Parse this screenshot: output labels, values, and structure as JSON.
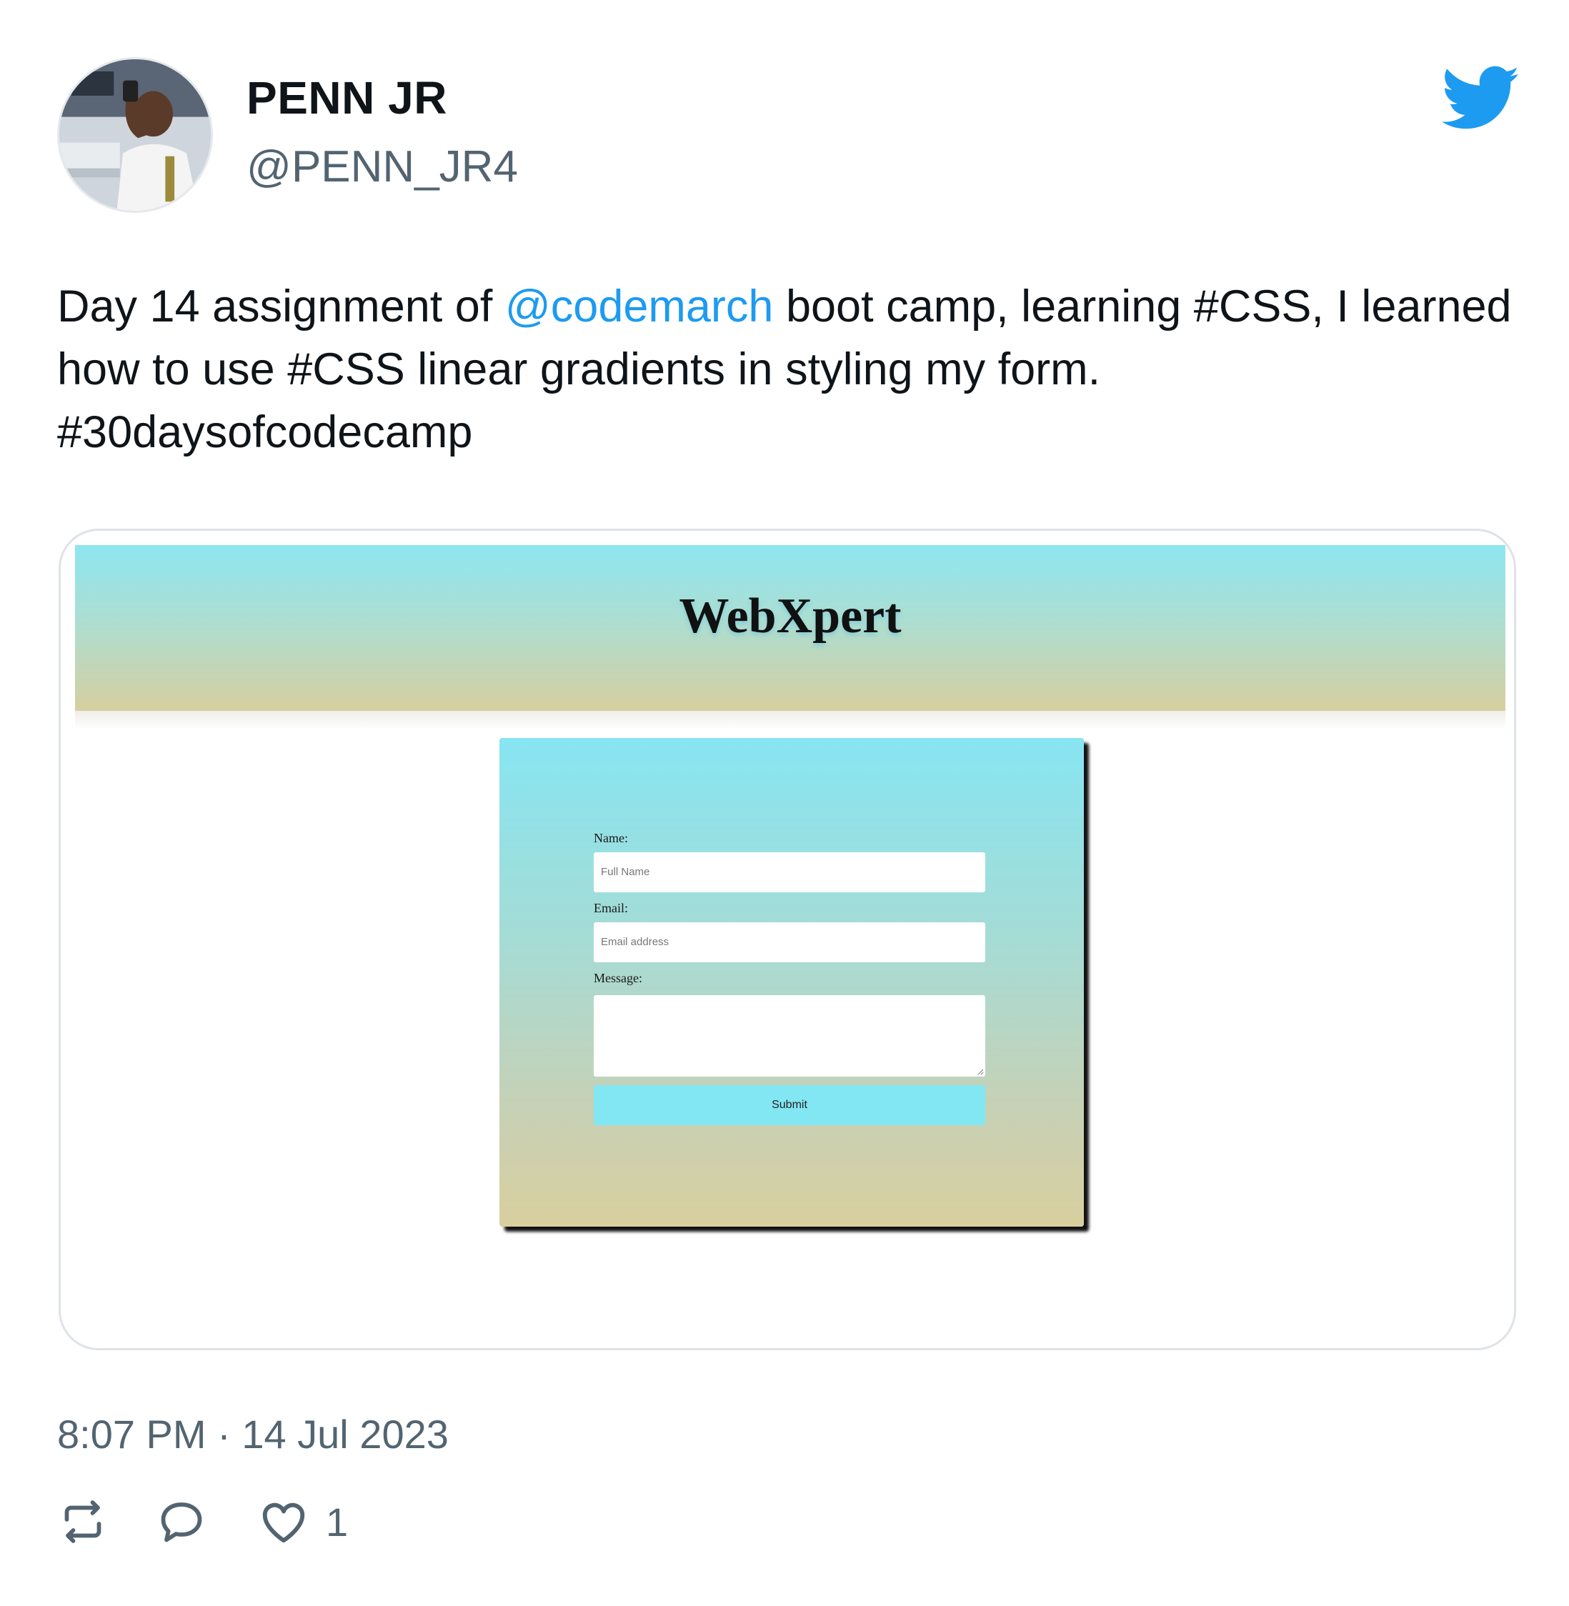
{
  "author": {
    "display_name": "PENN JR",
    "handle": "@PENN_JR4",
    "avatar_icon": "profile-photo"
  },
  "brand_icon": "twitter-bird-icon",
  "tweet": {
    "text_before_mention": "Day 14 assignment of ",
    "mention": "@codemarch",
    "text_after_mention": " boot camp, learning #CSS, I learned how to use #CSS linear gradients in styling my form. #30daysofcodecamp"
  },
  "media": {
    "site_title": "WebXpert",
    "form": {
      "name_label": "Name:",
      "name_placeholder": "Full Name",
      "email_label": "Email:",
      "email_placeholder": "Email address",
      "message_label": "Message:",
      "submit_label": "Submit"
    }
  },
  "footer": {
    "timestamp": "8:07 PM · 14 Jul 2023",
    "like_count": "1"
  },
  "colors": {
    "link": "#1d9bf0",
    "muted": "#536471",
    "text": "#0f1419",
    "gradient_top": "#8ee6f0",
    "gradient_bottom": "#d6cf9f",
    "submit_bg": "#83e6f3"
  }
}
